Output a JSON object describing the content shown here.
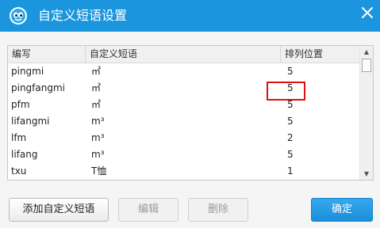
{
  "dialog": {
    "title": "自定义短语设置",
    "icon": "app-logo-icon",
    "close_icon": "close-icon"
  },
  "list": {
    "headers": [
      "编写",
      "自定义短语",
      "排列位置"
    ],
    "rows": [
      {
        "code": "pingmi",
        "phrase": "㎡",
        "position": "5"
      },
      {
        "code": "pingfangmi",
        "phrase": "㎡",
        "position": "5"
      },
      {
        "code": "pfm",
        "phrase": "㎡",
        "position": "5"
      },
      {
        "code": "lifangmi",
        "phrase": "m³",
        "position": "5"
      },
      {
        "code": "lfm",
        "phrase": "m³",
        "position": "2"
      },
      {
        "code": "lifang",
        "phrase": "m³",
        "position": "5"
      },
      {
        "code": "txu",
        "phrase": "T恤",
        "position": "1"
      }
    ],
    "highlight_color": "#e01010"
  },
  "buttons": {
    "add": "添加自定义短语",
    "edit": "编辑",
    "delete": "删除",
    "ok": "确定"
  },
  "colors": {
    "titlebar": "#1b96de",
    "primary_button": "#1a8fd8"
  }
}
